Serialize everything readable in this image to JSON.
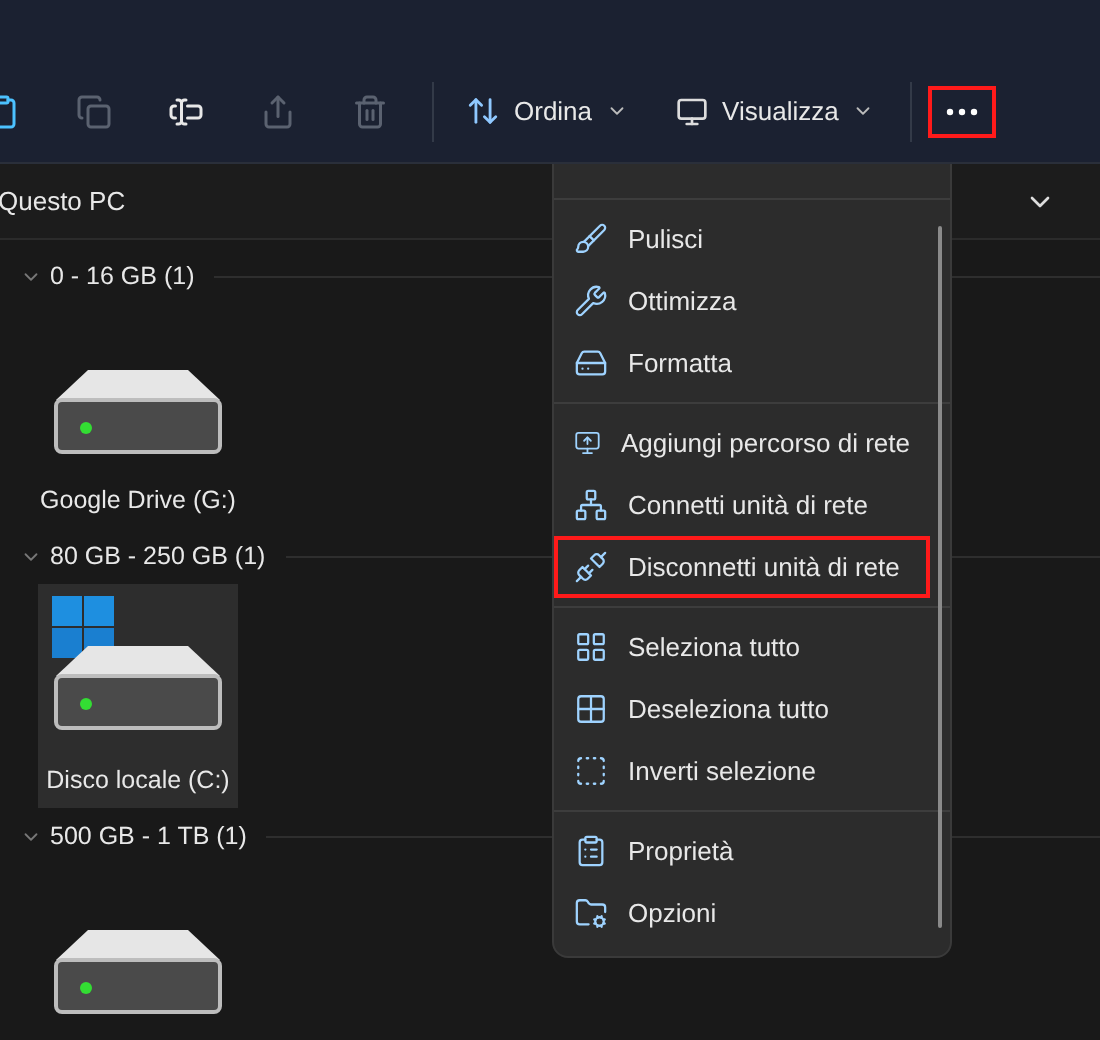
{
  "toolbar": {
    "icon_buttons": [
      {
        "disabled": false
      },
      {
        "disabled": true
      },
      {
        "disabled": false
      },
      {
        "disabled": true
      },
      {
        "disabled": true
      }
    ],
    "sort_button": {
      "label": "Ordina"
    },
    "view_button": {
      "label": "Visualizza"
    },
    "more_button": {
      "highlighted": true
    }
  },
  "address_bar": {
    "path": "Questo PC"
  },
  "groups": [
    {
      "label": "0 - 16 GB (1)",
      "expanded": true,
      "items": [
        {
          "kind": "drive",
          "name": "Google Drive (G:)",
          "selected": false
        }
      ]
    },
    {
      "label": "80 GB - 250 GB (1)",
      "expanded": true,
      "items": [
        {
          "kind": "system",
          "name": "Disco locale (C:)",
          "selected": true
        }
      ]
    },
    {
      "label": "500 GB - 1 TB (1)",
      "expanded": true,
      "items": [
        {
          "kind": "drive",
          "selected": false
        }
      ]
    }
  ],
  "menu": {
    "sections": [
      [
        {
          "label": "Pulisci",
          "highlighted": false
        },
        {
          "label": "Ottimizza",
          "highlighted": false
        },
        {
          "label": "Formatta",
          "highlighted": false
        }
      ],
      [
        {
          "label": "Aggiungi percorso di rete",
          "highlighted": false
        },
        {
          "label": "Connetti unità di rete",
          "highlighted": false
        },
        {
          "label": "Disconnetti unità di rete",
          "highlighted": true
        }
      ],
      [
        {
          "label": "Seleziona tutto",
          "highlighted": false
        },
        {
          "label": "Deseleziona tutto",
          "highlighted": false
        },
        {
          "label": "Inverti selezione",
          "highlighted": false
        }
      ],
      [
        {
          "label": "Proprietà",
          "highlighted": false
        },
        {
          "label": "Opzioni",
          "highlighted": false
        }
      ]
    ]
  }
}
